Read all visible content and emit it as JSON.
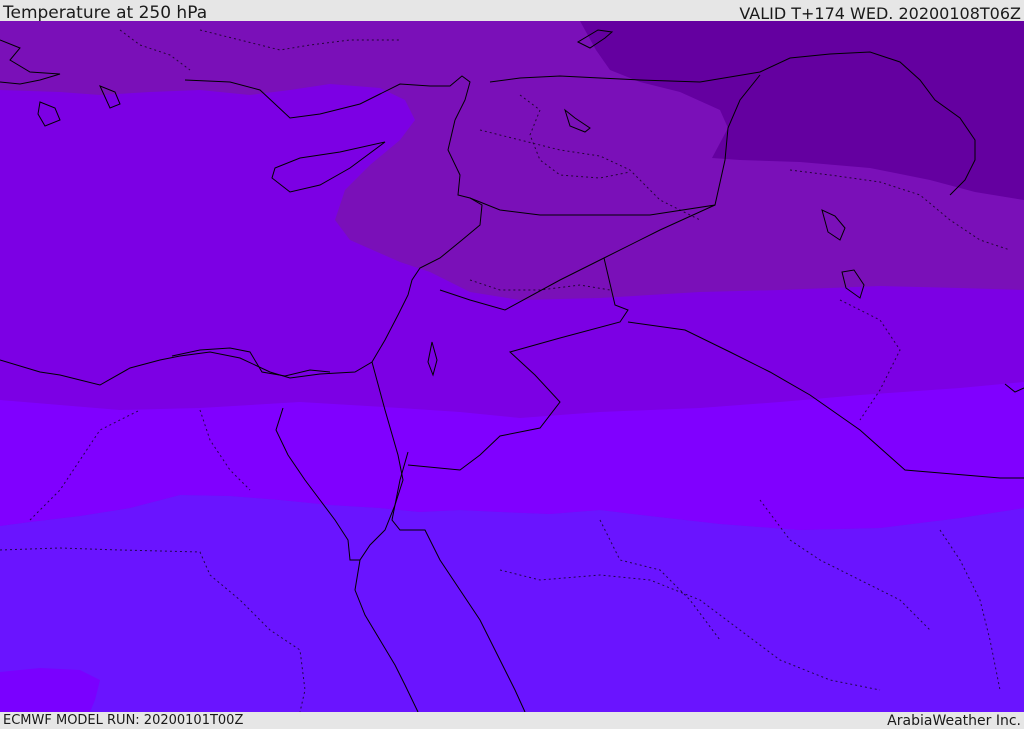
{
  "header": {
    "title": "Temperature at 250 hPa",
    "valid": "VALID T+174 WED. 20200108T06Z"
  },
  "footer": {
    "model_run": "ECMWF MODEL RUN: 20200101T00Z",
    "credit": "ArabiaWeather Inc."
  },
  "map": {
    "field": "temperature",
    "level": "250 hPa",
    "band_colors": [
      "#6600a0",
      "#7a10b8",
      "#7c00e4",
      "#8000ff",
      "#6a14ff",
      "#7a00ff"
    ],
    "border_color": "#000000"
  }
}
